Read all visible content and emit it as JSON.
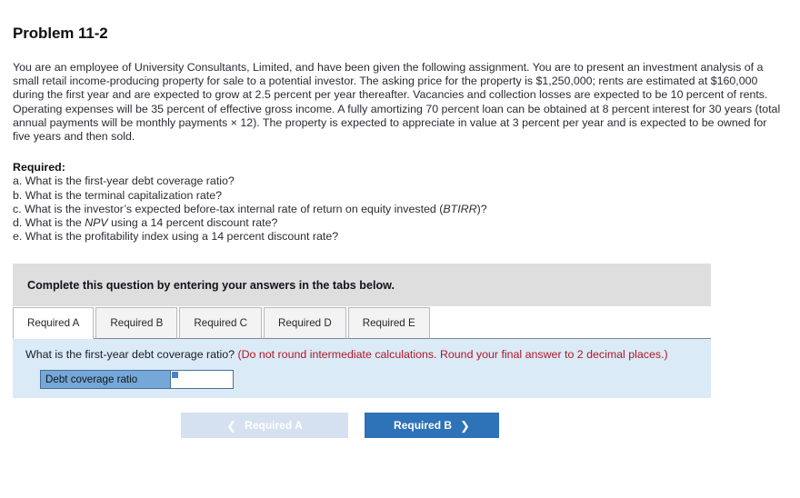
{
  "page_title": "Problem 11-2",
  "problem_body": "You are an employee of University Consultants, Limited, and have been given the following assignment. You are to present an investment analysis of a small retail income-producing property for sale to a potential investor. The asking price for the property is $1,250,000; rents are estimated at $160,000 during the first year and are expected to grow at 2.5 percent per year thereafter. Vacancies and collection losses are expected to be 10 percent of rents. Operating expenses will be 35 percent of effective gross income. A fully amortizing 70 percent loan can be obtained at 8 percent interest for 30 years (total annual payments will be monthly payments × 12). The property is expected to appreciate in value at 3 percent per year and is expected to be owned for five years and then sold.",
  "required": {
    "label": "Required:",
    "items": [
      {
        "prefix": "a. What is the first-year debt coverage ratio?",
        "italic": "",
        "suffix": ""
      },
      {
        "prefix": "b. What is the terminal capitalization rate?",
        "italic": "",
        "suffix": ""
      },
      {
        "prefix": "c. What is the investor’s expected before-tax internal rate of return on equity invested (",
        "italic": "BTIRR",
        "suffix": ")?"
      },
      {
        "prefix": "d. What is the ",
        "italic": "NPV",
        "suffix": " using a 14 percent discount rate?"
      },
      {
        "prefix": "e. What is the profitability index using a 14 percent discount rate?",
        "italic": "",
        "suffix": ""
      }
    ]
  },
  "instruction_banner": "Complete this question by entering your answers in the tabs below.",
  "tabs": [
    {
      "label": "Required A",
      "active": true
    },
    {
      "label": "Required B",
      "active": false
    },
    {
      "label": "Required C",
      "active": false
    },
    {
      "label": "Required D",
      "active": false
    },
    {
      "label": "Required E",
      "active": false
    }
  ],
  "question": {
    "prompt": "What is the first-year debt coverage ratio?",
    "note": "(Do not round intermediate calculations. Round your final answer to 2 decimal places.)"
  },
  "answer_row": {
    "label": "Debt coverage ratio",
    "value": "",
    "placeholder": ""
  },
  "nav": {
    "prev_label": "Required A",
    "prev_icon": "chevron-left-icon",
    "next_label": "Required B",
    "next_icon": "chevron-right-icon"
  },
  "colors": {
    "banner_gray": "#dededf",
    "panel_blue": "#daeaf7",
    "label_blue": "#75a7d8",
    "button_blue": "#2e72b8",
    "button_disabled": "#d5e1f0",
    "note_red": "#b01827"
  }
}
